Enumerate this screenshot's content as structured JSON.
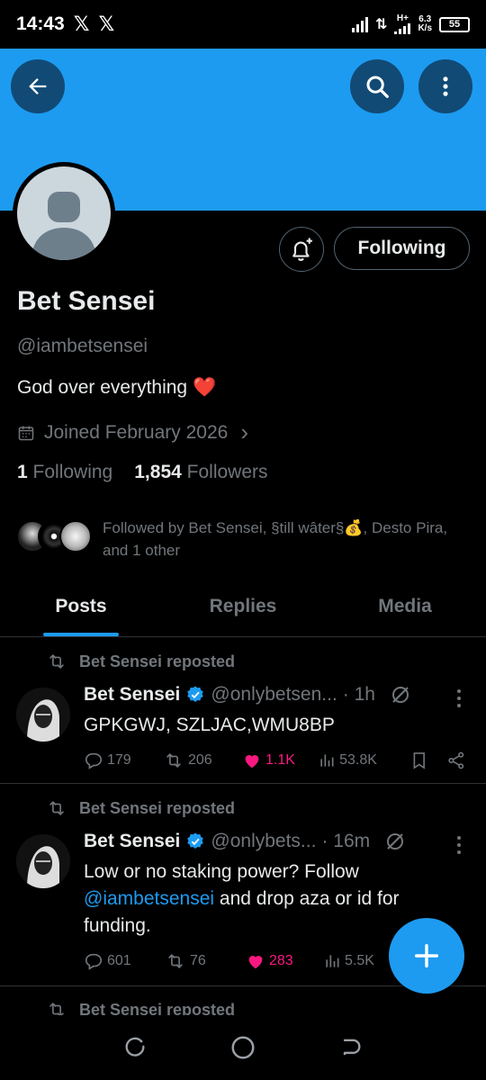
{
  "status_bar": {
    "time": "14:43",
    "notif_icons": [
      "x-logo-icon",
      "x-logo-icon"
    ],
    "net_type": "H+",
    "speed_value": "6.3",
    "speed_unit": "K/s",
    "battery": "55"
  },
  "header": {
    "back_icon": "back-arrow-icon",
    "search_icon": "search-icon",
    "more_icon": "more-vertical-icon"
  },
  "profile": {
    "name": "Bet Sensei",
    "handle": "@iambetsensei",
    "bio": "God over everything",
    "bio_emoji": "❤️",
    "joined": "Joined February 2026",
    "following_count": "1",
    "following_label": "Following",
    "followers_count": "1,854",
    "followers_label": "Followers",
    "follow_button": "Following",
    "followed_by_text": "Followed by Bet Sensei, §till wâter§💰, Desto Pira, and 1 other"
  },
  "tabs": [
    {
      "label": "Posts",
      "active": true
    },
    {
      "label": "Replies",
      "active": false
    },
    {
      "label": "Media",
      "active": false
    }
  ],
  "posts": [
    {
      "repost_label": "Bet Sensei reposted",
      "name": "Bet Sensei",
      "handle": "@onlybetsen...",
      "time": "· 1h",
      "text": "GPKGWJ, SZLJAC,WMU8BP",
      "replies": "179",
      "reposts": "206",
      "likes": "1.1K",
      "views": "53.8K"
    },
    {
      "repost_label": "Bet Sensei reposted",
      "name": "Bet Sensei",
      "handle": "@onlybets...",
      "time": "· 16m",
      "text_before": "Low or no staking power? Follow",
      "mention": "@iambetsensei",
      "text_after": "and drop aza or id for funding.",
      "replies": "601",
      "reposts": "76",
      "likes": "283",
      "views": "5.5K"
    },
    {
      "repost_label": "Bet Sensei reposted"
    }
  ],
  "colors": {
    "accent": "#1d9bf0",
    "like": "#f91880",
    "muted": "#71767b",
    "text": "#e7e9ea"
  }
}
